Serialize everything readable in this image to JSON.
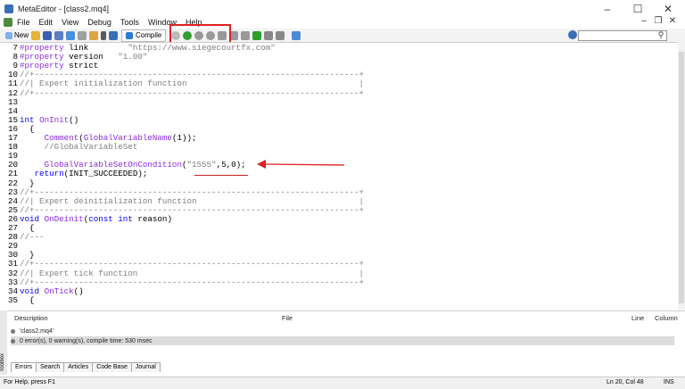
{
  "window": {
    "title": "MetaEditor - [class2.mq4]",
    "controls": [
      "–",
      "☐",
      "✕"
    ]
  },
  "menu": {
    "items": [
      "File",
      "Edit",
      "View",
      "Debug",
      "Tools",
      "Window",
      "Help"
    ]
  },
  "toolbar": {
    "new_label": "New",
    "compile_label": "Compile"
  },
  "editor": {
    "lines": [
      {
        "n": "7",
        "code": "#property link        \"https://www.siegecourtfx.com\""
      },
      {
        "n": "8",
        "code": "#property version   \"1.00\""
      },
      {
        "n": "9",
        "code": "#property strict"
      },
      {
        "n": "10",
        "code": "//+------------------------------------------------------------------+"
      },
      {
        "n": "11",
        "code": "//| Expert initialization function                                   |"
      },
      {
        "n": "12",
        "code": "//+------------------------------------------------------------------+"
      },
      {
        "n": "13",
        "code": ""
      },
      {
        "n": "14",
        "code": ""
      },
      {
        "n": "15",
        "code": "int OnInit()"
      },
      {
        "n": "16",
        "code": "  {"
      },
      {
        "n": "17",
        "code": "     Comment(GlobalVariableName(1));"
      },
      {
        "n": "18",
        "code": "     //GlobalVariableSet"
      },
      {
        "n": "19",
        "code": ""
      },
      {
        "n": "20",
        "code": "     GlobalVariableSetOnCondition(\"1555\",5,0);"
      },
      {
        "n": "21",
        "code": "   return(INIT_SUCCEEDED);"
      },
      {
        "n": "22",
        "code": "  }"
      },
      {
        "n": "23",
        "code": "//+------------------------------------------------------------------+"
      },
      {
        "n": "24",
        "code": "//| Expert deinitialization function                                 |"
      },
      {
        "n": "25",
        "code": "//+------------------------------------------------------------------+"
      },
      {
        "n": "26",
        "code": "void OnDeinit(const int reason)"
      },
      {
        "n": "27",
        "code": "  {"
      },
      {
        "n": "28",
        "code": "//---"
      },
      {
        "n": "29",
        "code": ""
      },
      {
        "n": "30",
        "code": "  }"
      },
      {
        "n": "31",
        "code": "//+------------------------------------------------------------------+"
      },
      {
        "n": "32",
        "code": "//| Expert tick function                                             |"
      },
      {
        "n": "33",
        "code": "//+------------------------------------------------------------------+"
      },
      {
        "n": "34",
        "code": "void OnTick()"
      },
      {
        "n": "35",
        "code": "  {"
      }
    ]
  },
  "toolbox": {
    "columns": {
      "description": "Description",
      "file": "File",
      "line": "Line",
      "column": "Column"
    },
    "rows": [
      {
        "text": "'class2.mq4'"
      },
      {
        "text": "0 error(s), 0 warning(s), compile time: 530 msec"
      }
    ],
    "side_label": "Toolbox",
    "tabs": [
      "Errors",
      "Search",
      "Articles",
      "Code Base",
      "Journal"
    ]
  },
  "status": {
    "help": "For Help, press F1",
    "position": "Ln 20, Col 48",
    "mode": "INS"
  },
  "colors": {
    "keyword": "#0000ff",
    "comment": "#808080",
    "string": "#808080",
    "function": "#8a2be2",
    "highlight": "#e02020"
  }
}
